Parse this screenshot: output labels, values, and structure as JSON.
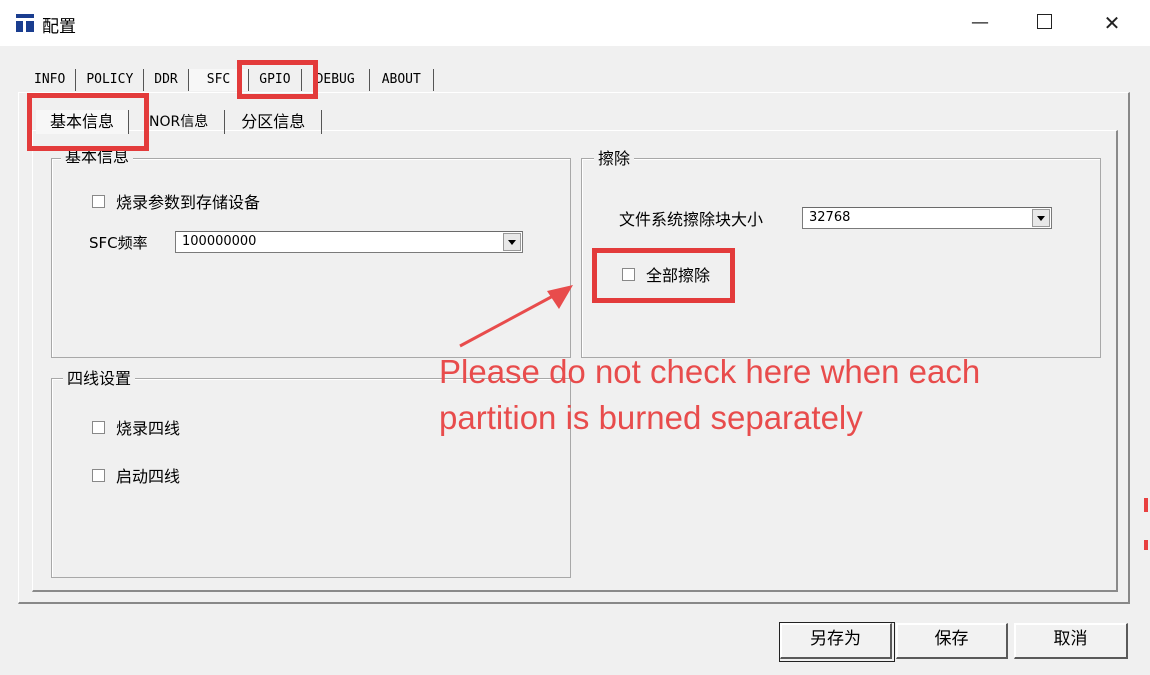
{
  "window": {
    "title": "配置",
    "minimize": "—",
    "close": "✕"
  },
  "tabs_top": [
    {
      "label": "INFO"
    },
    {
      "label": "POLICY"
    },
    {
      "label": "DDR"
    },
    {
      "label": "SFC"
    },
    {
      "label": "GPIO"
    },
    {
      "label": "DEBUG"
    },
    {
      "label": "ABOUT"
    }
  ],
  "tabs_sub": [
    {
      "label": "基本信息"
    },
    {
      "label": "NOR信息"
    },
    {
      "label": "分区信息"
    }
  ],
  "basic_group": {
    "title": "基本信息",
    "burn_params_label": "烧录参数到存储设备",
    "burn_params_checked": false,
    "sfc_freq_label": "SFC频率",
    "sfc_freq_value": "100000000"
  },
  "quad_group": {
    "title": "四线设置",
    "burn_quad_label": "烧录四线",
    "burn_quad_checked": false,
    "boot_quad_label": "启动四线",
    "boot_quad_checked": false
  },
  "erase_group": {
    "title": "擦除",
    "block_size_label": "文件系统擦除块大小",
    "block_size_value": "32768",
    "erase_all_label": "全部擦除",
    "erase_all_checked": false
  },
  "buttons": {
    "save_as": "另存为",
    "save": "保存",
    "cancel": "取消"
  },
  "annotation": {
    "line1": "Please do not check here when each",
    "line2": "partition is burned separately",
    "color": "#e84c4c",
    "highlight_color": "#e33b3b"
  }
}
